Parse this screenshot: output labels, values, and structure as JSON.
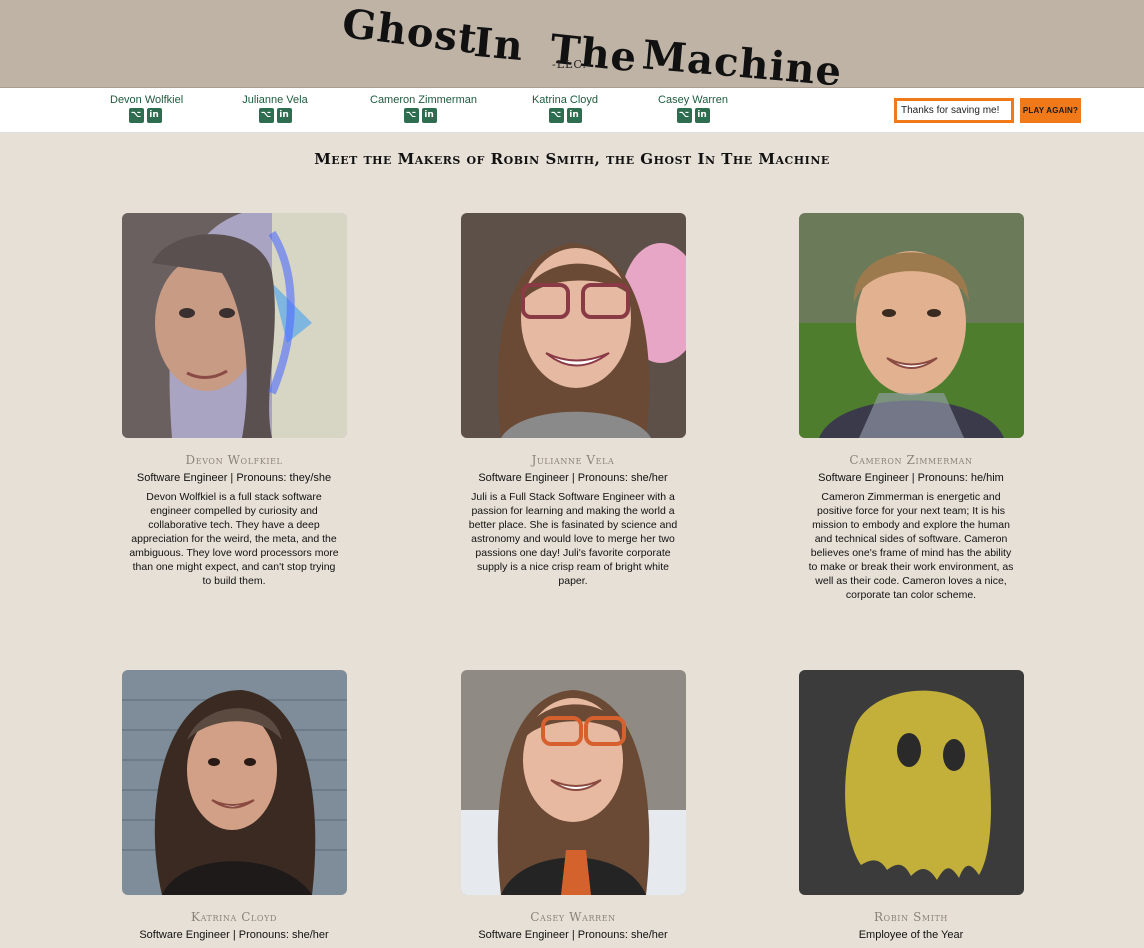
{
  "site": {
    "title_words": [
      "Ghost",
      "In",
      "The",
      "Machine"
    ],
    "subtitle": "-LLC.-"
  },
  "nav": {
    "people": [
      {
        "name": "Devon Wolfkiel"
      },
      {
        "name": "Julianne Vela"
      },
      {
        "name": "Cameron Zimmerman"
      },
      {
        "name": "Katrina Cloyd"
      },
      {
        "name": "Casey Warren"
      }
    ],
    "message_value": "Thanks for saving me!",
    "play_label": "PLAY AGAIN?"
  },
  "main": {
    "heading": "Meet the Makers of Robin Smith, the Ghost In The Machine",
    "cards": [
      {
        "name": "Devon Wolfkiel",
        "role": "Software Engineer | Pronouns: they/she",
        "bio": "Devon Wolfkiel is a full stack software engineer compelled by curiosity and collaborative tech. They have a deep appreciation for the weird, the meta, and the ambiguous. They love word processors more than one might expect, and can't stop trying to build them."
      },
      {
        "name": "Julianne Vela",
        "role": "Software Engineer | Pronouns: she/her",
        "bio": "Juli is a Full Stack Software Engineer with a passion for learning and making the world a better place. She is fasinated by science and astronomy and would love to merge her two passions one day! Juli's favorite corporate supply is a nice crisp ream of bright white paper."
      },
      {
        "name": "Cameron Zimmerman",
        "role": "Software Engineer | Pronouns: he/him",
        "bio": "Cameron Zimmerman is energetic and positive force for your next team; It is his mission to embody and explore the human and technical sides of software. Cameron believes one's frame of mind has the ability to make or break their work environment, as well as their code. Cameron loves a nice, corporate tan color scheme."
      },
      {
        "name": "Katrina Cloyd",
        "role": "Software Engineer | Pronouns: she/her",
        "bio": ""
      },
      {
        "name": "Casey Warren",
        "role": "Software Engineer | Pronouns: she/her",
        "bio": ""
      },
      {
        "name": "Robin Smith",
        "role": "Employee of the Year",
        "bio": ""
      }
    ]
  },
  "colors": {
    "page_bg": "#e7e0d7",
    "header_bg": "#bfb3a6",
    "accent_orange": "#f07a1a",
    "nav_green": "#2f6d50",
    "ghost_yellow": "#c3b03a"
  },
  "icons": [
    "github-icon",
    "linkedin-icon",
    "ghost-icon"
  ]
}
